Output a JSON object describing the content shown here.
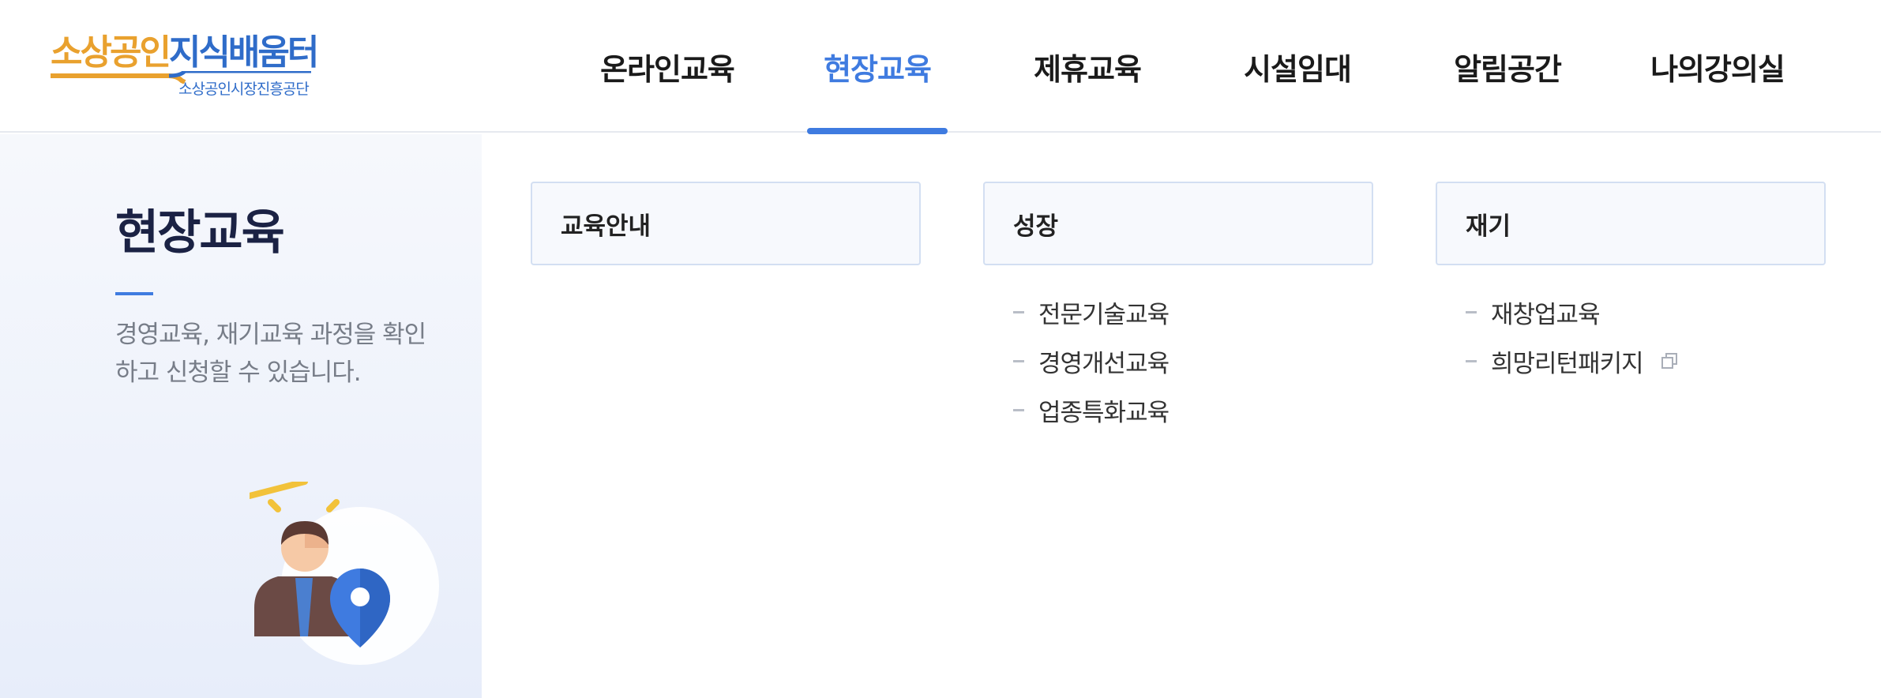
{
  "logo": {
    "main_orange": "소상공인",
    "main_blue": "지식배움터",
    "sub": "소상공인시장진흥공단"
  },
  "nav": {
    "items": [
      {
        "label": "온라인교육",
        "active": false
      },
      {
        "label": "현장교육",
        "active": true
      },
      {
        "label": "제휴교육",
        "active": false
      },
      {
        "label": "시설임대",
        "active": false
      },
      {
        "label": "알림공간",
        "active": false
      },
      {
        "label": "나의강의실",
        "active": false
      }
    ]
  },
  "side": {
    "title": "현장교육",
    "description": "경영교육, 재기교육 과정을 확인하고 신청할 수 있습니다."
  },
  "menu": {
    "columns": [
      {
        "heading": "교육안내",
        "items": []
      },
      {
        "heading": "성장",
        "items": [
          "전문기술교육",
          "경영개선교육",
          "업종특화교육"
        ]
      },
      {
        "heading": "재기",
        "items": [
          "재창업교육",
          "희망리턴패키지"
        ]
      }
    ]
  },
  "colors": {
    "accent": "#3f7be0",
    "logo_orange": "#e9a12e",
    "logo_blue": "#2f6cc9",
    "title": "#1b2244"
  },
  "icons": {
    "external_link": "external-link-icon",
    "illustration": "person-location-pin-illustration"
  }
}
